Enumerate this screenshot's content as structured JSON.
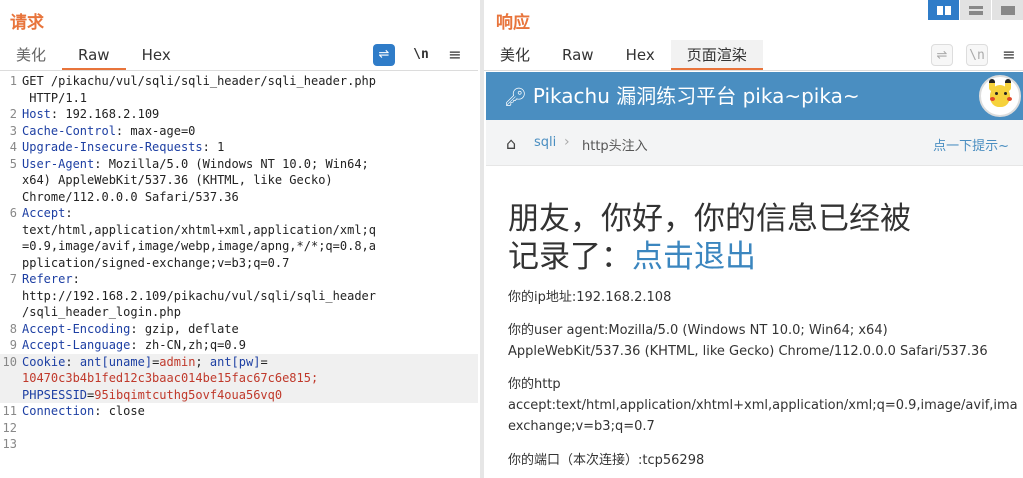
{
  "request": {
    "title": "请求",
    "tabs": [
      "美化",
      "Raw",
      "Hex"
    ],
    "active_tab": "Raw",
    "tools": {
      "newline": "\\n",
      "menu": "≡"
    },
    "lines": [
      {
        "no": "1",
        "text": "GET /pikachu/vul/sqli/sqli_header/sqli_header.php"
      },
      {
        "no": "",
        "text": " HTTP/1.1"
      },
      {
        "no": "2",
        "key": "Host",
        "val": " 192.168.2.109"
      },
      {
        "no": "3",
        "key": "Cache-Control",
        "val": " max-age=0"
      },
      {
        "no": "4",
        "key": "Upgrade-Insecure-Requests",
        "val": " 1"
      },
      {
        "no": "5",
        "key": "User-Agent",
        "val": " Mozilla/5.0 (Windows NT 10.0; Win64;"
      },
      {
        "no": "",
        "text": "x64) AppleWebKit/537.36 (KHTML, like Gecko)"
      },
      {
        "no": "",
        "text": "Chrome/112.0.0.0 Safari/537.36"
      },
      {
        "no": "6",
        "key": "Accept",
        "val": ""
      },
      {
        "no": "",
        "text": "text/html,application/xhtml+xml,application/xml;q"
      },
      {
        "no": "",
        "text": "=0.9,image/avif,image/webp,image/apng,*/*;q=0.8,a"
      },
      {
        "no": "",
        "text": "pplication/signed-exchange;v=b3;q=0.7"
      },
      {
        "no": "7",
        "key": "Referer",
        "val": ""
      },
      {
        "no": "",
        "text": "http://192.168.2.109/pikachu/vul/sqli/sqli_header"
      },
      {
        "no": "",
        "text": "/sqli_header_login.php"
      },
      {
        "no": "8",
        "key": "Accept-Encoding",
        "val": " gzip, deflate"
      },
      {
        "no": "9",
        "key": "Accept-Language",
        "val": " zh-CN,zh;q=0.9"
      },
      {
        "no": "10",
        "cookie": true,
        "k1": "Cookie",
        "c1": "ant[uname]",
        "v1": "admin",
        "c2": "ant[pw]"
      },
      {
        "no": "",
        "cookie_cont": "10470c3b4b1fed12c3baac014be15fac67c6e815;"
      },
      {
        "no": "",
        "cookie_cont2_k": "PHPSESSID",
        "cookie_cont2_v": "95ibqimtcuthg5ovf4oua56vq0"
      },
      {
        "no": "11",
        "key": "Connection",
        "val": " close"
      },
      {
        "no": "12",
        "text": ""
      },
      {
        "no": "13",
        "text": ""
      }
    ]
  },
  "response": {
    "title": "响应",
    "tabs": [
      "美化",
      "Raw",
      "Hex",
      "页面渲染"
    ],
    "active_tab": "页面渲染",
    "tools": {
      "newline": "\\n",
      "menu": "≡"
    },
    "page": {
      "header_title": "Pikachu 漏洞练习平台 pika~pika~",
      "breadcrumb_link": "sqli",
      "breadcrumb_sep": "›",
      "breadcrumb_current": "http头注入",
      "hint": "点一下提示~",
      "message_line1": "朋友，你好，你的信息已经被",
      "message_line2_prefix": "记录了：",
      "logout_link": "点击退出",
      "ip_line": "你的ip地址:192.168.2.108",
      "ua_line1": "你的user agent:Mozilla/5.0 (Windows NT 10.0; Win64; x64)",
      "ua_line2": "AppleWebKit/537.36 (KHTML, like Gecko) Chrome/112.0.0.0 Safari/537.36",
      "http_accept_label": "你的http",
      "accept_line1": "accept:text/html,application/xhtml+xml,application/xml;q=0.9,image/avif,ima",
      "accept_line2": "exchange;v=b3;q=0.7",
      "port_line": "你的端口（本次连接）:tcp56298"
    }
  },
  "colors": {
    "accent": "#e8743b",
    "button_blue": "#2f7cc8",
    "header_blue": "#4a8ec1",
    "link": "#3b86bf"
  },
  "icons": [
    "wrap-lines-icon",
    "newline-icon",
    "menu-icon",
    "key-icon",
    "home-icon",
    "pikachu-avatar",
    "layout-icons"
  ]
}
